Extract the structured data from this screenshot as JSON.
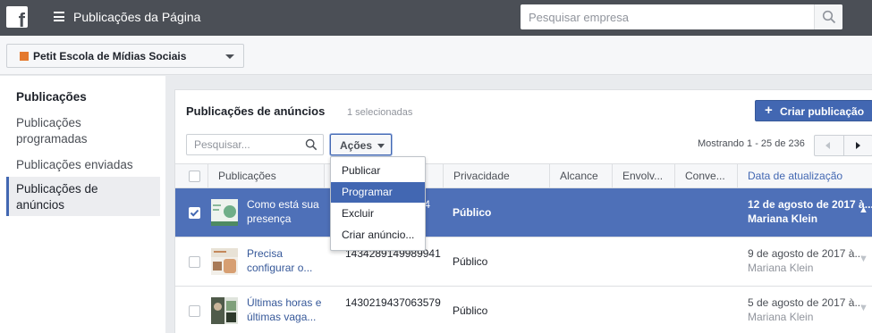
{
  "topbar": {
    "logo_glyph": "f",
    "title": "Publicações da Página",
    "search_placeholder": "Pesquisar empresa"
  },
  "page_selector": {
    "name": "Petit Escola de Mídias Sociais"
  },
  "sidebar": {
    "items": [
      {
        "label": "Publicações"
      },
      {
        "label": "Publicações programadas"
      },
      {
        "label": "Publicações enviadas"
      },
      {
        "label": "Publicações de anúncios"
      }
    ]
  },
  "main": {
    "title": "Publicações de anúncios",
    "selected_count": "1 selecionadas",
    "create_button": "Criar publicação",
    "search_placeholder": "Pesquisar...",
    "actions_label": "Ações",
    "pager_text": "Mostrando 1 - 25 de 236"
  },
  "table": {
    "columns": [
      "Publicações",
      "",
      "Privacidade",
      "Alcance",
      "Envolv...",
      "Conve...",
      "Data de atualização"
    ],
    "rows": [
      {
        "title": "Como está sua presença",
        "id": "4",
        "privacy": "Público",
        "date": "12 de agosto de 2017 à...",
        "author": "Mariana Klein",
        "selected": true
      },
      {
        "title": "Precisa configurar o...",
        "id": "1434289149989941",
        "privacy": "Público",
        "date": "9 de agosto de 2017 à...",
        "author": "Mariana Klein",
        "selected": false
      },
      {
        "title": "Últimas horas e últimas vaga...",
        "id": "1430219437063579",
        "privacy": "Público",
        "date": "5 de agosto de 2017 à...",
        "author": "Mariana Klein",
        "selected": false
      }
    ]
  },
  "dropdown": {
    "items": [
      "Publicar",
      "Programar",
      "Excluir",
      "Criar anúncio..."
    ],
    "highlighted": "Programar"
  },
  "colors": {
    "topbar": "#4b4f56",
    "accent": "#4267b2",
    "selected_row": "#4e70b8",
    "brand_icon": "#e4792e"
  }
}
